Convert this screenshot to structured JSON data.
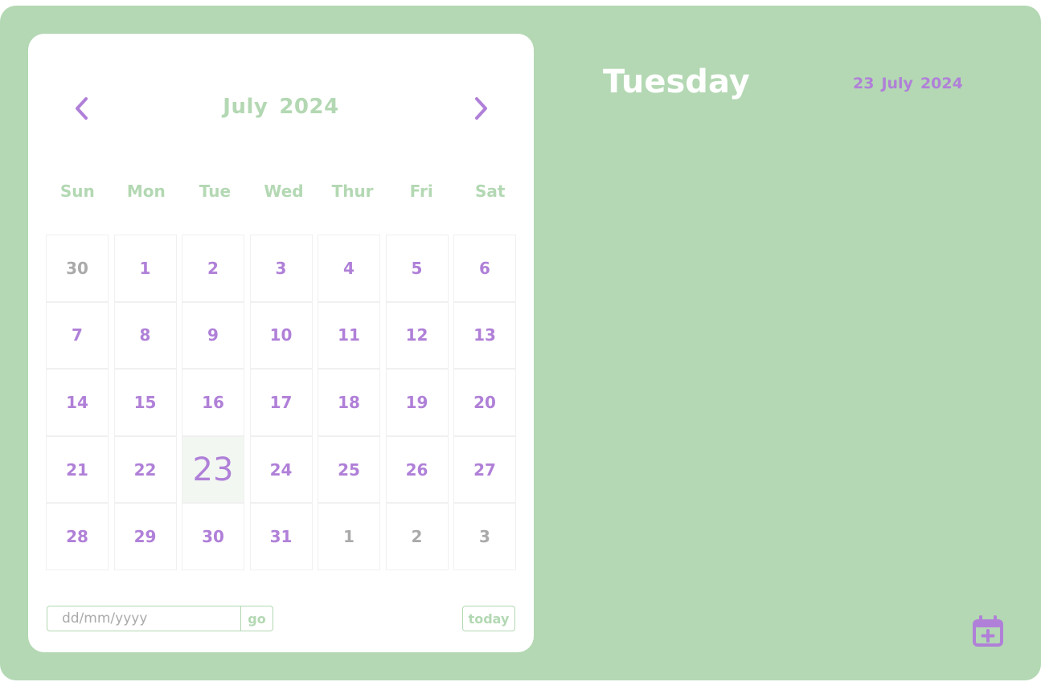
{
  "calendar": {
    "month": "July",
    "year": "2024",
    "weekdays": [
      "Sun",
      "Mon",
      "Tue",
      "Wed",
      "Thur",
      "Fri",
      "Sat"
    ],
    "days": [
      {
        "label": "30",
        "other": true
      },
      {
        "label": "1"
      },
      {
        "label": "2"
      },
      {
        "label": "3"
      },
      {
        "label": "4"
      },
      {
        "label": "5"
      },
      {
        "label": "6"
      },
      {
        "label": "7"
      },
      {
        "label": "8"
      },
      {
        "label": "9"
      },
      {
        "label": "10"
      },
      {
        "label": "11"
      },
      {
        "label": "12"
      },
      {
        "label": "13"
      },
      {
        "label": "14"
      },
      {
        "label": "15"
      },
      {
        "label": "16"
      },
      {
        "label": "17"
      },
      {
        "label": "18"
      },
      {
        "label": "19"
      },
      {
        "label": "20"
      },
      {
        "label": "21"
      },
      {
        "label": "22"
      },
      {
        "label": "23",
        "today": true
      },
      {
        "label": "24"
      },
      {
        "label": "25"
      },
      {
        "label": "26"
      },
      {
        "label": "27"
      },
      {
        "label": "28"
      },
      {
        "label": "29"
      },
      {
        "label": "30"
      },
      {
        "label": "31"
      },
      {
        "label": "1",
        "other": true
      },
      {
        "label": "2",
        "other": true
      },
      {
        "label": "3",
        "other": true
      }
    ]
  },
  "footer": {
    "date_placeholder": "dd/mm/yyyy",
    "go_label": "go",
    "today_label": "today"
  },
  "detail": {
    "day_name": "Tuesday",
    "day": "23",
    "month": "July",
    "year": "2024"
  },
  "icons": {
    "prev": "chevron-left-icon",
    "next": "chevron-right-icon",
    "add_event": "calendar-plus-icon"
  },
  "colors": {
    "background": "#b3d8b3",
    "accent": "#b080d8",
    "muted": "#aaaaaa",
    "card": "#ffffff"
  }
}
